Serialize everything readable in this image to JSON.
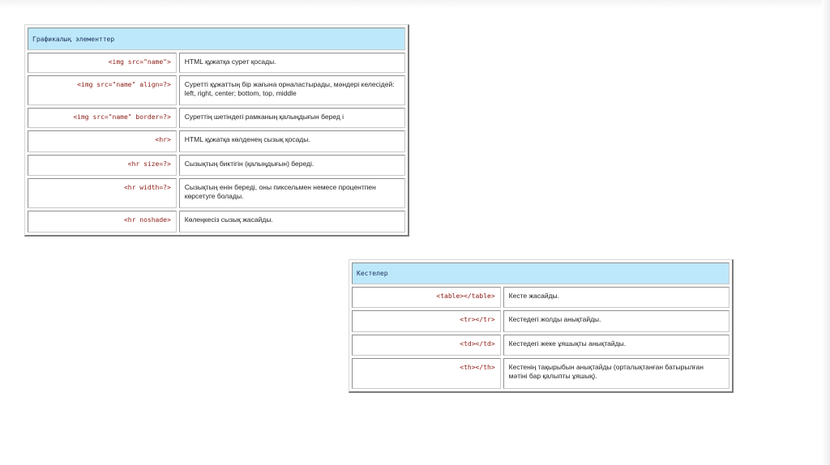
{
  "table1": {
    "header": "Графикалық  элементтер",
    "rows": [
      {
        "tag": "<img src=\"name\">",
        "desc": "HTML құжатқа сурет қосады."
      },
      {
        "tag": "<img src=\"name\" align=?>",
        "desc": "Суретті құжаттың бір жағына орналастырады, мәндері келесідей: left, right, center; bottom, top, middle"
      },
      {
        "tag": "<img src=\"name\" border=?>",
        "desc": "Суреттің шетіндегі рамканың қалыңдығын беред і"
      },
      {
        "tag": "<hr>",
        "desc": "HTML құжатқа көлденең сызық қосады."
      },
      {
        "tag": "<hr size=?>",
        "desc": "Сызықтың биктігін (қалыңдығын) береді."
      },
      {
        "tag": "<hr width=?>",
        "desc": "Сызықтың енін береді, оны пиксельмен немесе процентпен көрсетуге болады."
      },
      {
        "tag": "<hr noshade>",
        "desc": "Көлеңкесіз сызық жасайды."
      }
    ]
  },
  "table2": {
    "header": "Кестелер",
    "rows": [
      {
        "tag": "<table></table>",
        "desc": "Кесте жасайды."
      },
      {
        "tag": "<tr></tr>",
        "desc": "Кестедегі жолды анықтайды."
      },
      {
        "tag": "<td></td>",
        "desc": "Кестедегі жеке ұяшықты анықтайды."
      },
      {
        "tag": "<th></th>",
        "desc": "Кестенің тақырыбын анықтайды (орталықтанған батырылған мәтіні бар қалыпты ұяшық)."
      }
    ]
  }
}
